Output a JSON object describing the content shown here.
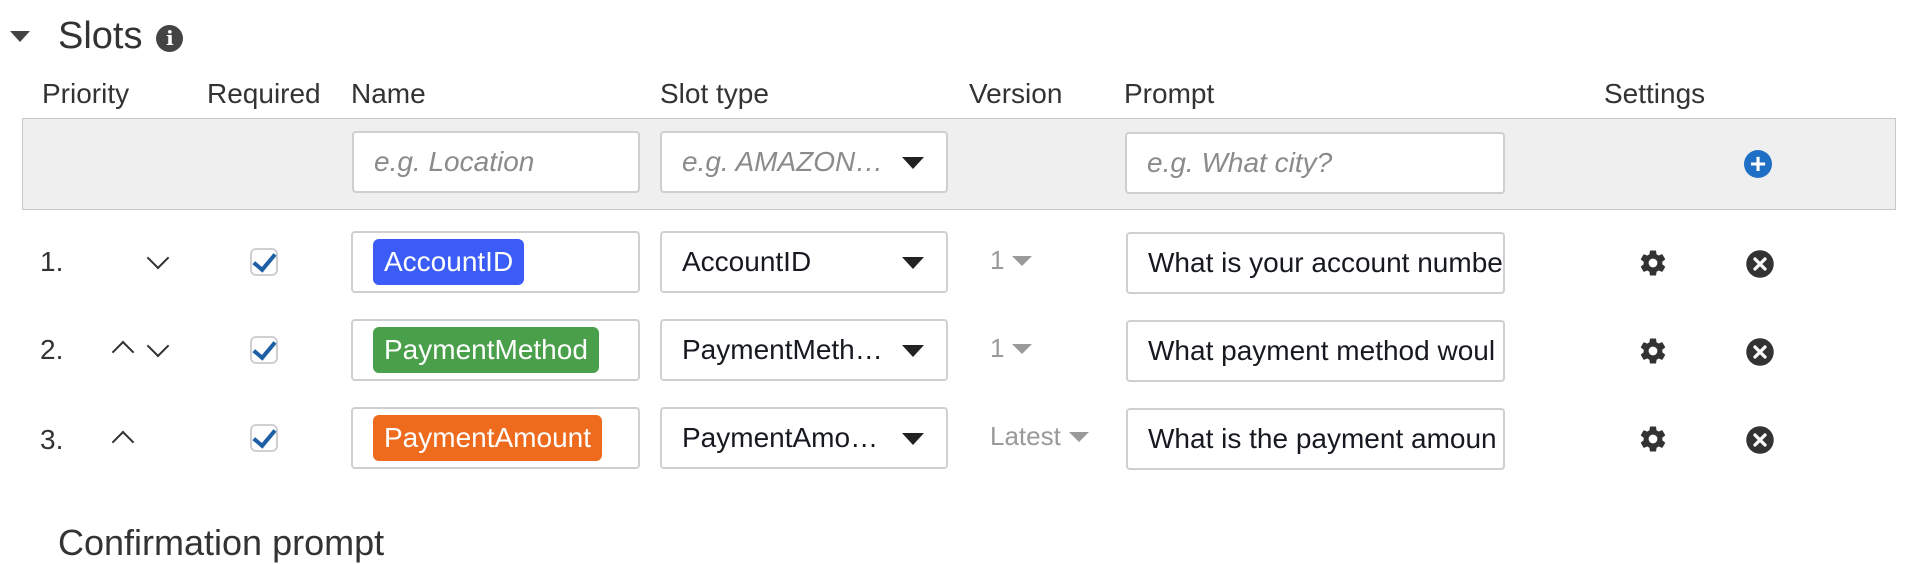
{
  "section": {
    "title": "Slots",
    "info_icon": "info-icon",
    "caret_icon": "caret-down-icon"
  },
  "columns": {
    "priority": "Priority",
    "required": "Required",
    "name": "Name",
    "slot_type": "Slot type",
    "version": "Version",
    "prompt": "Prompt",
    "settings": "Settings"
  },
  "new_slot": {
    "name_placeholder": "e.g. Location",
    "slot_type_placeholder": "e.g. AMAZON…",
    "prompt_placeholder": "e.g. What city?",
    "add_icon": "plus-circle-icon"
  },
  "slots": [
    {
      "number": "1.",
      "name": "AccountID",
      "badge_color": "#3b5cf6",
      "slot_type": "AccountID",
      "version": "1",
      "prompt": "What is your account numbe",
      "required": true,
      "move_up": false,
      "move_down": true
    },
    {
      "number": "2.",
      "name": "PaymentMethod",
      "badge_color": "#4aa04a",
      "slot_type": "PaymentMeth…",
      "version": "1",
      "prompt": "What payment method woul",
      "required": true,
      "move_up": true,
      "move_down": true
    },
    {
      "number": "3.",
      "name": "PaymentAmount",
      "badge_color": "#ee6b1e",
      "slot_type": "PaymentAmo…",
      "version": "Latest",
      "prompt": "What is the payment amoun",
      "required": true,
      "move_up": true,
      "move_down": false
    }
  ],
  "next_section": {
    "title": "Confirmation prompt"
  },
  "colors": {
    "accent": "#1f6fc5",
    "checkbox": "#1f5fa6",
    "header_row_bg": "#efefef"
  }
}
